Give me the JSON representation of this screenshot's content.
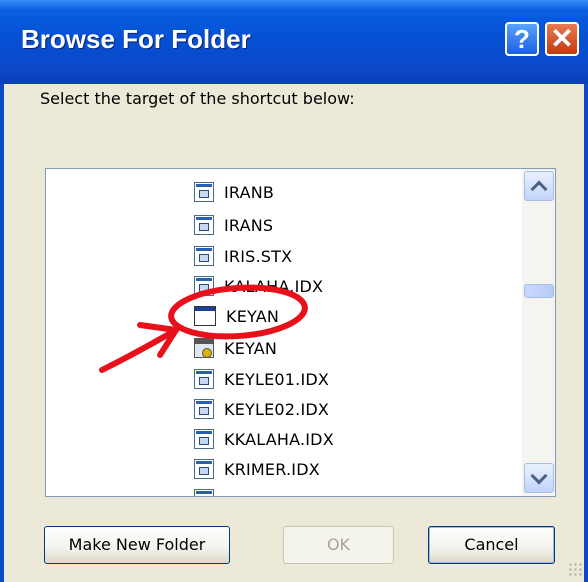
{
  "window": {
    "title": "Browse For Folder",
    "help_glyph": "?",
    "close_glyph": "✕"
  },
  "instruction": "Select the target of the shortcut below:",
  "tree": {
    "items": [
      {
        "label": "IRANB",
        "icon": "file-icon"
      },
      {
        "label": "IRANS",
        "icon": "file-icon"
      },
      {
        "label": "IRIS.STX",
        "icon": "file-icon"
      },
      {
        "label": "KALAHA.IDX",
        "icon": "file-icon"
      },
      {
        "label": "KEYAN",
        "icon": "application-icon"
      },
      {
        "label": "KEYAN",
        "icon": "shortcut-icon"
      },
      {
        "label": "KEYLE01.IDX",
        "icon": "file-icon"
      },
      {
        "label": "KEYLE02.IDX",
        "icon": "file-icon"
      },
      {
        "label": "KKALAHA.IDX",
        "icon": "file-icon"
      },
      {
        "label": "KRIMER.IDX",
        "icon": "file-icon"
      }
    ]
  },
  "buttons": {
    "make_new_folder": "Make New Folder",
    "ok": "OK",
    "cancel": "Cancel"
  },
  "colors": {
    "titlebar": "#0550d4",
    "annotation": "#e8101a",
    "dialog_bg": "#ece9d8"
  }
}
